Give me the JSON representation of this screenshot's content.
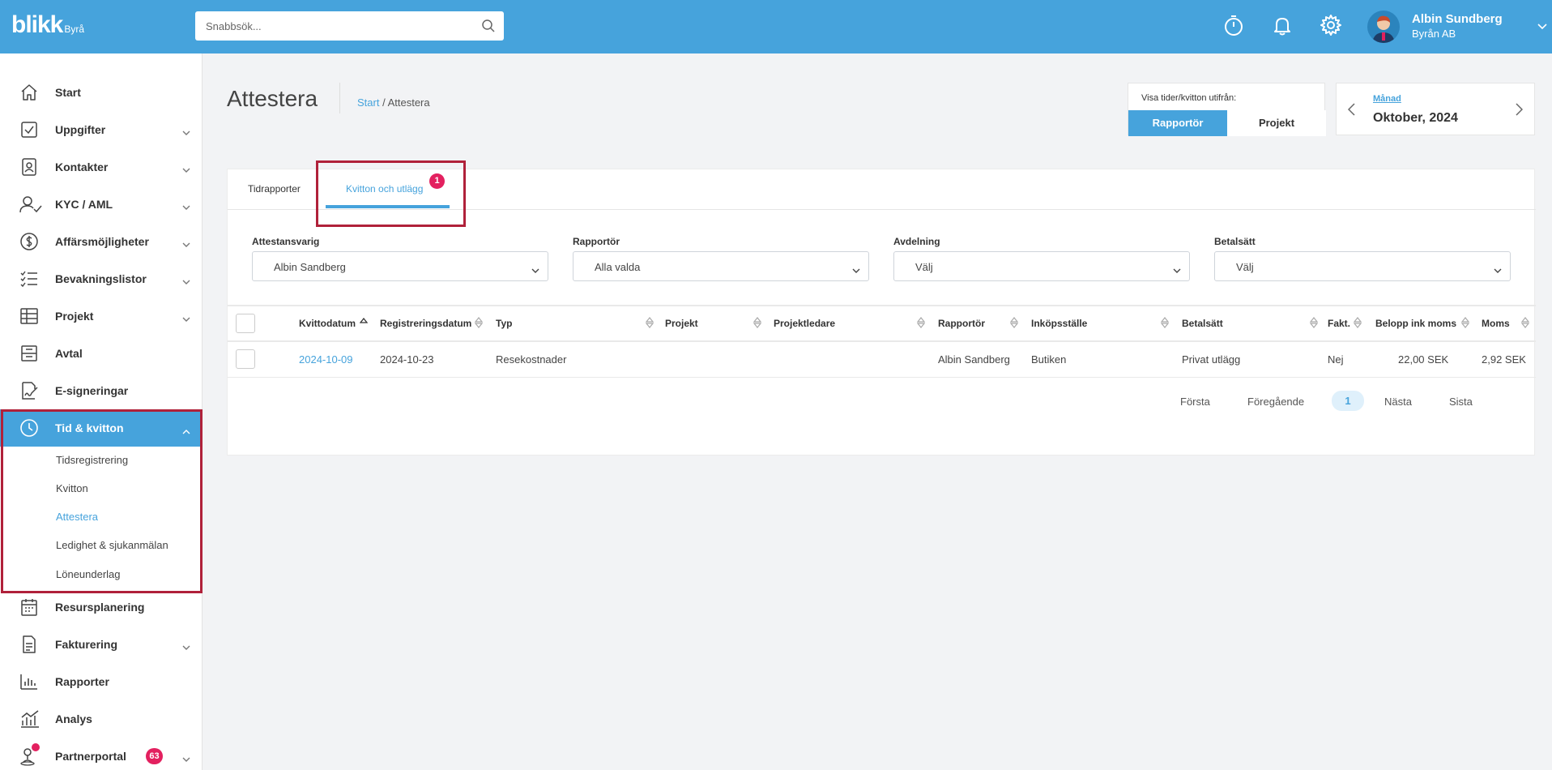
{
  "app": {
    "logo_text": "blikk",
    "logo_sub": "Byrå",
    "search_placeholder": "Snabbsök..."
  },
  "user": {
    "name": "Albin Sundberg",
    "company": "Byrån AB"
  },
  "topbar_icons": [
    "stopwatch-icon",
    "bell-icon",
    "gear-icon"
  ],
  "sidebar": {
    "items": [
      {
        "label": "Start",
        "icon": "home-icon"
      },
      {
        "label": "Uppgifter",
        "icon": "checkbox-icon"
      },
      {
        "label": "Kontakter",
        "icon": "contact-card-icon"
      },
      {
        "label": "KYC / AML",
        "icon": "user-check-icon"
      },
      {
        "label": "Affärsmöjligheter",
        "icon": "dollar-icon"
      },
      {
        "label": "Bevakningslistor",
        "icon": "checklist-icon"
      },
      {
        "label": "Projekt",
        "icon": "table-icon"
      },
      {
        "label": "Avtal",
        "icon": "document-box-icon"
      },
      {
        "label": "E-signeringar",
        "icon": "signature-icon"
      },
      {
        "label": "Tid & kvitton",
        "icon": "clock-icon"
      },
      {
        "label": "Resursplanering",
        "icon": "calendar-icon"
      },
      {
        "label": "Fakturering",
        "icon": "invoice-icon"
      },
      {
        "label": "Rapporter",
        "icon": "bar-chart-icon"
      },
      {
        "label": "Analys",
        "icon": "analytics-icon"
      },
      {
        "label": "Partnerportal",
        "icon": "partner-icon",
        "badge": "63"
      }
    ],
    "sub_items": [
      "Tidsregistrering",
      "Kvitton",
      "Attestera",
      "Ledighet & sjukanmälan",
      "Löneunderlag"
    ],
    "current_sub": "Attestera"
  },
  "page": {
    "title": "Attestera",
    "breadcrumb_start": "Start",
    "breadcrumb_sep": " / ",
    "breadcrumb_current": "Attestera"
  },
  "view_toggle": {
    "label": "Visa tider/kvitton utifrån:",
    "options": [
      "Rapportör",
      "Projekt"
    ],
    "selected": "Rapportör"
  },
  "period": {
    "label": "Månad",
    "value": "Oktober, 2024"
  },
  "tabs": [
    {
      "label": "Tidrapporter"
    },
    {
      "label": "Kvitton och utlägg",
      "badge": "1",
      "active": true
    }
  ],
  "filters": [
    {
      "label": "Attestansvarig",
      "value": "Albin Sandberg"
    },
    {
      "label": "Rapportör",
      "value": "Alla valda"
    },
    {
      "label": "Avdelning",
      "value": "Välj"
    },
    {
      "label": "Betalsätt",
      "value": "Välj"
    }
  ],
  "table": {
    "columns": [
      "Kvittodatum",
      "Registreringsdatum",
      "Typ",
      "Projekt",
      "Projektledare",
      "Rapportör",
      "Inköpsställe",
      "Betalsätt",
      "Fakt.",
      "Belopp ink moms",
      "Moms"
    ],
    "rows": [
      [
        "2024-10-09",
        "2024-10-23",
        "Resekostnader",
        "",
        "",
        "Albin Sandberg",
        "Butiken",
        "Privat utlägg",
        "Nej",
        "22,00 SEK",
        "2,92 SEK"
      ]
    ]
  },
  "pagination": {
    "first": "Första",
    "prev": "Föregående",
    "current": "1",
    "next": "Nästa",
    "last": "Sista"
  },
  "colors": {
    "brand": "#46a3dc",
    "badge": "#e3205f",
    "highlight": "#b0213a"
  }
}
